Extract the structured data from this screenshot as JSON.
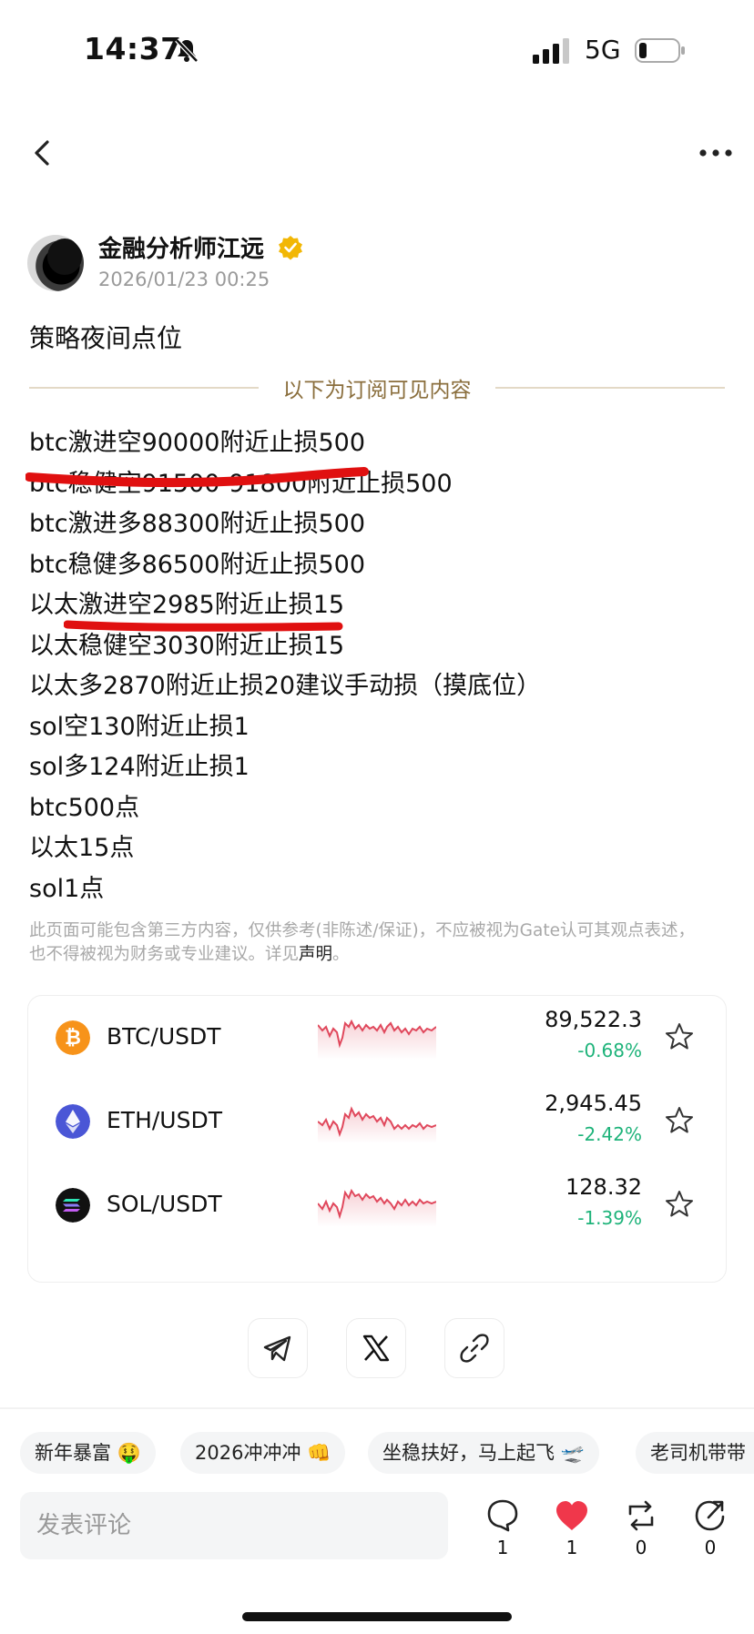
{
  "status_bar": {
    "time": "14:37",
    "network": "5G"
  },
  "author": {
    "name": "金融分析师江远",
    "timestamp": "2026/01/23 00:25"
  },
  "post": {
    "title": "策略夜间点位",
    "subscription_divider": "以下为订阅可见内容",
    "lines": [
      "btc激进空90000附近止损500",
      "btc稳健空91500-91800附近止损500",
      "btc激进多88300附近止损500",
      "btc稳健多86500附近止损500",
      "以太激进空2985附近止损15",
      "以太稳健空3030附近止损15",
      "以太多2870附近止损20建议手动损（摸底位）",
      "sol空130附近止损1",
      "sol多124附近止损1",
      "btc500点",
      "以太15点",
      "sol1点"
    ],
    "disclaimer": "此页面可能包含第三方内容，仅供参考(非陈述/保证)，不应被视为Gate认可其观点表述，也不得被视为财务或专业建议。详见",
    "disclaimer_link": "声明",
    "disclaimer_end": "。"
  },
  "markets": [
    {
      "pair": "BTC/USDT",
      "price": "89,522.3",
      "change": "-0.68%",
      "icon": "bitcoin-icon",
      "color": "#f7931a"
    },
    {
      "pair": "ETH/USDT",
      "price": "2,945.45",
      "change": "-2.42%",
      "icon": "ethereum-icon",
      "color": "#4a56d6"
    },
    {
      "pair": "SOL/USDT",
      "price": "128.32",
      "change": "-1.39%",
      "icon": "solana-icon",
      "color": "#111111"
    }
  ],
  "quick_replies": [
    "新年暴富 🤑",
    "2026冲冲冲 👊",
    "坐稳扶好，马上起飞 🛫",
    "老司机带带"
  ],
  "comment": {
    "placeholder": "发表评论"
  },
  "actions": {
    "comments": "1",
    "likes": "1",
    "reposts": "0",
    "shares": "0"
  },
  "colors": {
    "accent_gold": "#8a6e3c",
    "change_green": "#1eb37a",
    "annotation_red": "#e01010",
    "sparkline_red": "#e0485c"
  }
}
